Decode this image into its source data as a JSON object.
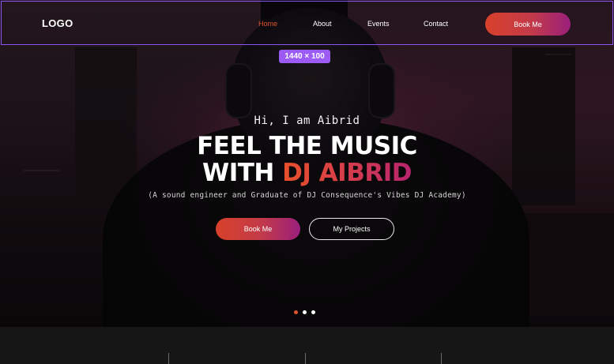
{
  "header": {
    "logo": "LOGO",
    "nav": [
      {
        "label": "Home",
        "active": true
      },
      {
        "label": "About",
        "active": false
      },
      {
        "label": "Events",
        "active": false
      },
      {
        "label": "Contact",
        "active": false
      }
    ],
    "book_label": "Book Me"
  },
  "size_badge": "1440 × 100",
  "hero": {
    "greeting": "Hi, I am Aibrid",
    "headline_line1": "FEEL THE MUSIC",
    "headline_line2_prefix": "WITH ",
    "headline_line2_accent": "DJ AIBRID",
    "subtitle": "(A sound engineer and Graduate of DJ Consequence's Vibes DJ Academy)",
    "primary_button": "Book Me",
    "secondary_button": "My Projects",
    "slide_count": 3,
    "active_slide": 1
  },
  "colors": {
    "accent_orange": "#e0522c",
    "accent_gradient_start": "#d8412a",
    "accent_gradient_end": "#9a1f7c",
    "selection_outline": "#8a55f0",
    "badge": "#9b5bf4"
  }
}
